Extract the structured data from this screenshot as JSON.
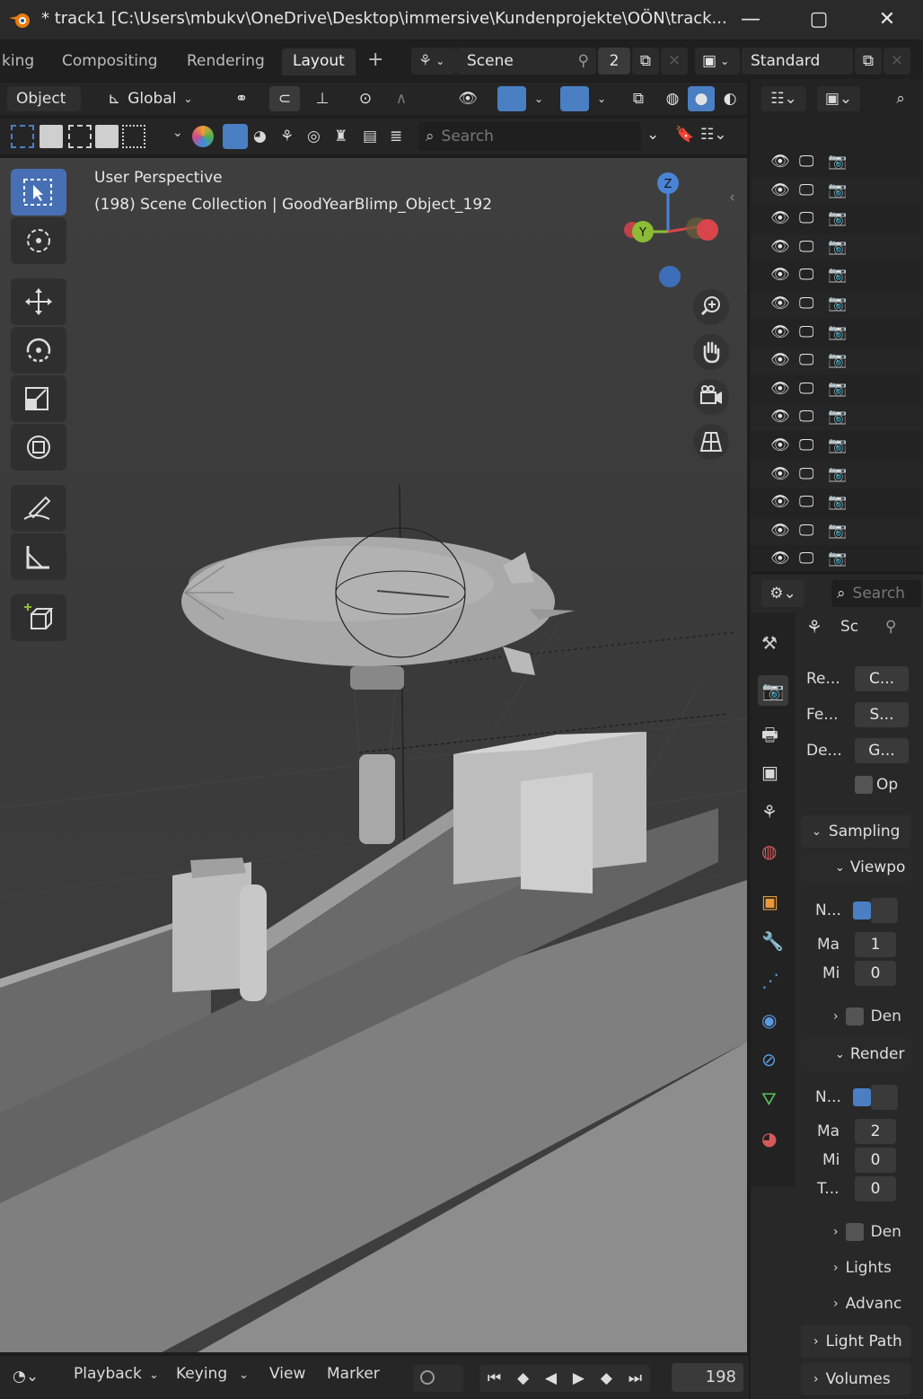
{
  "window": {
    "title": "* track1 [C:\\Users\\mbukv\\OneDrive\\Desktop\\immersive\\Kundenprojekte\\OÖN\\track...",
    "minimize": "—",
    "maximize": "▢",
    "close": "✕"
  },
  "workspace_tabs": [
    {
      "label": "king"
    },
    {
      "label": "Compositing"
    },
    {
      "label": "Rendering"
    },
    {
      "label": "Layout",
      "active": true
    },
    {
      "label": "+"
    }
  ],
  "scene": {
    "name": "Scene",
    "count": "2"
  },
  "view_layer": {
    "name": "Standard"
  },
  "viewport_header": {
    "mode": "Object",
    "orientation": "Global",
    "search_placeholder": "Search"
  },
  "viewport": {
    "perspective": "User Perspective",
    "context": "(198) Scene Collection | GoodYearBlimp_Object_192",
    "gizmo": {
      "z": "Z",
      "y": "Y"
    }
  },
  "properties": {
    "search_placeholder": "Search",
    "scene_tab": "Sc",
    "render_rows": [
      {
        "label": "Re...",
        "value": "C..."
      },
      {
        "label": "Fe...",
        "value": "S..."
      },
      {
        "label": "De...",
        "value": "G..."
      }
    ],
    "op_label": "Op",
    "sampling_label": "Sampling",
    "viewport_label": "Viewpo",
    "viewport_rows": [
      {
        "label": "N...",
        "checked": true
      },
      {
        "label": "Ma",
        "value": "1"
      },
      {
        "label": "Mi",
        "value": "0"
      }
    ],
    "den_label_1": "Den",
    "render_label": "Render",
    "render_sample_rows": [
      {
        "label": "N...",
        "checked": true
      },
      {
        "label": "Ma",
        "value": "2"
      },
      {
        "label": "Mi",
        "value": "0"
      },
      {
        "label": "T...",
        "value": "0"
      }
    ],
    "den_label_2": "Den",
    "lights_label": "Lights",
    "advanced_label": "Advanc",
    "light_paths_label": "Light Path",
    "volumes_label": "Volumes"
  },
  "timeline": {
    "playback": "Playback",
    "keying": "Keying",
    "view": "View",
    "marker": "Marker",
    "frame": "198"
  },
  "colors": {
    "accent": "#4a7fc4",
    "axis_x": "#d8464b",
    "axis_y": "#8cbb36",
    "axis_z": "#4a84d6"
  }
}
